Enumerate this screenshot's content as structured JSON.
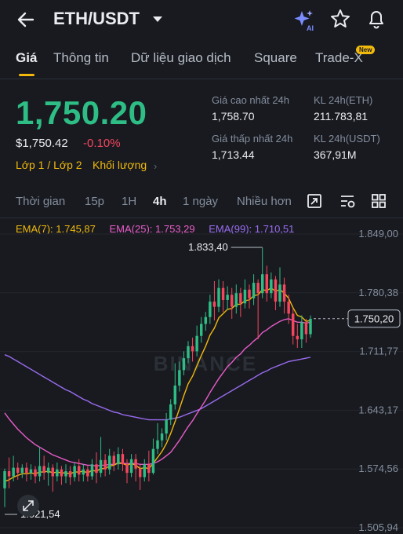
{
  "header": {
    "pair": "ETH/USDT"
  },
  "tabs": [
    {
      "label": "Giá",
      "active": true
    },
    {
      "label": "Thông tin"
    },
    {
      "label": "Dữ liệu giao dịch"
    },
    {
      "label": "Square"
    },
    {
      "label": "Trade-X"
    }
  ],
  "new_badge": "New",
  "price": {
    "last": "1,750.20",
    "usd": "$1,750.42",
    "change": "-0.10%",
    "layer_label": "Lớp 1 / Lớp 2",
    "volume_label": "Khối lượng"
  },
  "stats": {
    "high_label": "Giá cao nhất 24h",
    "high_value": "1,758.70",
    "low_label": "Giá thấp nhất 24h",
    "low_value": "1,713.44",
    "vol_eth_label": "KL 24h(ETH)",
    "vol_eth_value": "211.783,81",
    "vol_usdt_label": "KL 24h(USDT)",
    "vol_usdt_value": "367,91M"
  },
  "intervals": [
    {
      "label": "Thời gian"
    },
    {
      "label": "15p"
    },
    {
      "label": "1H"
    },
    {
      "label": "4h",
      "active": true
    },
    {
      "label": "1 ngày"
    },
    {
      "label": "Nhiều hơn"
    }
  ],
  "ema": {
    "ema7": "EMA(7): 1.745,87",
    "ema25": "EMA(25): 1.753,29",
    "ema99": "EMA(99): 1.710,51"
  },
  "colors": {
    "up": "#2ebd85",
    "down": "#f6465d",
    "ema7": "#f0b90b",
    "ema25": "#e95cc8",
    "ema99": "#9b6cf0",
    "accent": "#f0b90b"
  },
  "chart_data": {
    "type": "candlestick",
    "watermark": "BINANCE",
    "y_axis_labels": [
      "1.849,00",
      "1.780,38",
      "1.711,77",
      "1.643,17",
      "1.574,56",
      "1.505,94"
    ],
    "ylim": [
      1505.94,
      1849.0
    ],
    "last_price_label": "1.750,20",
    "last_price": 1750.2,
    "high_annotation": "1.833,40",
    "high_value": 1833.4,
    "low_annotation": "1.521,54",
    "low_value": 1521.54,
    "candles": [
      [
        1552,
        1572,
        1530,
        1575
      ],
      [
        1572,
        1566,
        1552,
        1588
      ],
      [
        1566,
        1576,
        1560,
        1590
      ],
      [
        1576,
        1570,
        1562,
        1582
      ],
      [
        1570,
        1576,
        1564,
        1580
      ],
      [
        1576,
        1570,
        1560,
        1582
      ],
      [
        1570,
        1574,
        1562,
        1580
      ],
      [
        1574,
        1566,
        1558,
        1578
      ],
      [
        1566,
        1578,
        1560,
        1600
      ],
      [
        1578,
        1570,
        1562,
        1590
      ],
      [
        1570,
        1576,
        1555,
        1582
      ],
      [
        1576,
        1566,
        1548,
        1580
      ],
      [
        1566,
        1574,
        1560,
        1582
      ],
      [
        1574,
        1566,
        1556,
        1578
      ],
      [
        1566,
        1572,
        1558,
        1580
      ],
      [
        1572,
        1565,
        1556,
        1578
      ],
      [
        1565,
        1578,
        1560,
        1582
      ],
      [
        1578,
        1568,
        1560,
        1586
      ],
      [
        1568,
        1574,
        1560,
        1580
      ],
      [
        1574,
        1566,
        1560,
        1578
      ],
      [
        1566,
        1580,
        1562,
        1586
      ],
      [
        1580,
        1570,
        1558,
        1594
      ],
      [
        1570,
        1585,
        1565,
        1612
      ],
      [
        1585,
        1574,
        1566,
        1592
      ],
      [
        1574,
        1590,
        1568,
        1598
      ],
      [
        1590,
        1580,
        1572,
        1595
      ],
      [
        1580,
        1592,
        1574,
        1600
      ],
      [
        1592,
        1580,
        1572,
        1598
      ],
      [
        1580,
        1570,
        1558,
        1586
      ],
      [
        1570,
        1586,
        1565,
        1592
      ],
      [
        1586,
        1575,
        1560,
        1592
      ],
      [
        1575,
        1565,
        1550,
        1580
      ],
      [
        1565,
        1580,
        1560,
        1586
      ],
      [
        1580,
        1570,
        1560,
        1596
      ],
      [
        1570,
        1598,
        1568,
        1610
      ],
      [
        1598,
        1608,
        1592,
        1628
      ],
      [
        1608,
        1616,
        1600,
        1622
      ],
      [
        1616,
        1632,
        1608,
        1640
      ],
      [
        1632,
        1650,
        1626,
        1656
      ],
      [
        1650,
        1672,
        1644,
        1698
      ],
      [
        1672,
        1690,
        1665,
        1700
      ],
      [
        1690,
        1704,
        1684,
        1712
      ],
      [
        1704,
        1718,
        1698,
        1724
      ],
      [
        1718,
        1712,
        1700,
        1728
      ],
      [
        1712,
        1730,
        1706,
        1742
      ],
      [
        1730,
        1744,
        1722,
        1752
      ],
      [
        1744,
        1752,
        1736,
        1758
      ],
      [
        1752,
        1770,
        1744,
        1778
      ],
      [
        1770,
        1764,
        1748,
        1794
      ],
      [
        1764,
        1786,
        1758,
        1796
      ],
      [
        1786,
        1772,
        1758,
        1794
      ],
      [
        1772,
        1778,
        1760,
        1788
      ],
      [
        1778,
        1764,
        1750,
        1786
      ],
      [
        1764,
        1780,
        1756,
        1790
      ],
      [
        1780,
        1768,
        1752,
        1786
      ],
      [
        1768,
        1784,
        1762,
        1796
      ],
      [
        1784,
        1774,
        1762,
        1790
      ],
      [
        1774,
        1792,
        1766,
        1802
      ],
      [
        1792,
        1780,
        1726,
        1796
      ],
      [
        1780,
        1802,
        1774,
        1833
      ],
      [
        1802,
        1780,
        1770,
        1812
      ],
      [
        1780,
        1796,
        1774,
        1804
      ],
      [
        1796,
        1770,
        1760,
        1800
      ],
      [
        1770,
        1790,
        1764,
        1810
      ],
      [
        1790,
        1770,
        1756,
        1798
      ],
      [
        1770,
        1756,
        1744,
        1778
      ],
      [
        1756,
        1730,
        1720,
        1762
      ],
      [
        1730,
        1726,
        1716,
        1744
      ],
      [
        1726,
        1746,
        1716,
        1754
      ],
      [
        1746,
        1732,
        1722,
        1750
      ],
      [
        1732,
        1750,
        1728,
        1754
      ]
    ],
    "ema7": [
      1560,
      1562,
      1565,
      1567,
      1569,
      1569,
      1570,
      1569,
      1571,
      1571,
      1572,
      1570,
      1571,
      1570,
      1570,
      1569,
      1571,
      1571,
      1572,
      1570,
      1573,
      1572,
      1575,
      1575,
      1578,
      1579,
      1582,
      1581,
      1579,
      1581,
      1579,
      1575,
      1576,
      1575,
      1581,
      1588,
      1595,
      1604,
      1616,
      1630,
      1645,
      1660,
      1674,
      1683,
      1695,
      1707,
      1718,
      1731,
      1739,
      1751,
      1756,
      1761,
      1762,
      1767,
      1767,
      1771,
      1772,
      1777,
      1778,
      1784,
      1783,
      1786,
      1782,
      1784,
      1780,
      1774,
      1763,
      1754,
      1752,
      1747,
      1748
    ],
    "ema25": [
      1640,
      1633,
      1627,
      1621,
      1616,
      1611,
      1607,
      1603,
      1600,
      1597,
      1594,
      1591,
      1589,
      1587,
      1585,
      1583,
      1582,
      1581,
      1580,
      1579,
      1579,
      1578,
      1579,
      1579,
      1580,
      1580,
      1581,
      1581,
      1581,
      1581,
      1581,
      1580,
      1580,
      1580,
      1581,
      1583,
      1586,
      1590,
      1594,
      1601,
      1608,
      1616,
      1624,
      1631,
      1639,
      1647,
      1655,
      1664,
      1672,
      1680,
      1687,
      1694,
      1699,
      1705,
      1709,
      1715,
      1719,
      1724,
      1728,
      1734,
      1737,
      1741,
      1744,
      1747,
      1749,
      1750,
      1748,
      1746,
      1746,
      1745,
      1746
    ],
    "ema99": [
      1708,
      1706,
      1703,
      1700,
      1697,
      1694,
      1691,
      1688,
      1685,
      1682,
      1679,
      1676,
      1673,
      1670,
      1667,
      1665,
      1662,
      1659,
      1656,
      1654,
      1651,
      1649,
      1647,
      1645,
      1643,
      1641,
      1640,
      1638,
      1637,
      1636,
      1635,
      1634,
      1633,
      1632,
      1632,
      1632,
      1632,
      1632,
      1633,
      1634,
      1635,
      1637,
      1639,
      1641,
      1643,
      1645,
      1648,
      1651,
      1654,
      1657,
      1660,
      1663,
      1666,
      1669,
      1672,
      1675,
      1678,
      1681,
      1684,
      1687,
      1689,
      1692,
      1694,
      1696,
      1698,
      1700,
      1701,
      1702,
      1703,
      1704,
      1705
    ]
  }
}
